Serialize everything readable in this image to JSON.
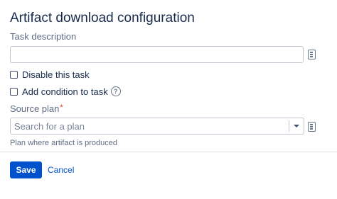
{
  "form": {
    "title": "Artifact download configuration",
    "task_description": {
      "label": "Task description",
      "value": "",
      "placeholder": ""
    },
    "disable_task": {
      "label": "Disable this task",
      "checked": false
    },
    "add_condition": {
      "label": "Add condition to task",
      "checked": false,
      "help_icon": "question-mark-icon"
    },
    "source_plan": {
      "label": "Source plan",
      "required_marker": "*",
      "placeholder": "Search for a plan",
      "hint": "Plan where artifact is produced"
    },
    "actions": {
      "save_label": "Save",
      "cancel_label": "Cancel"
    }
  },
  "icons": {
    "variables": "document-icon",
    "dropdown": "chevron-down-icon",
    "help": "question-mark-icon"
  },
  "colors": {
    "primary": "#0052cc",
    "text": "#172b4d",
    "subtle_text": "#5e6c84",
    "border": "#c1c7d0",
    "required": "#de350b"
  }
}
